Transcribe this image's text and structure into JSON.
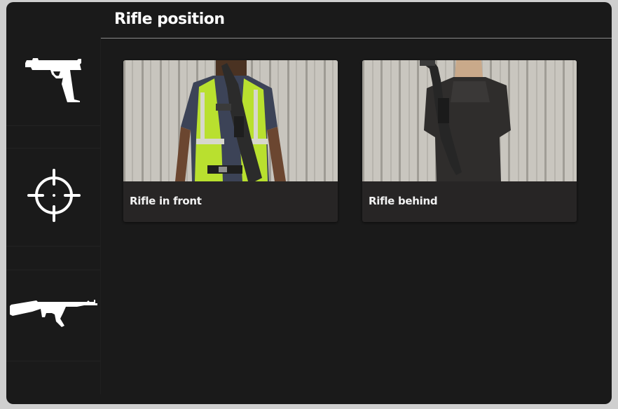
{
  "header": {
    "title": "Rifle position"
  },
  "sidebar": {
    "items": [
      {
        "icon": "pistol-icon",
        "label": ""
      },
      {
        "icon": "crosshair-icon",
        "label": ""
      },
      {
        "icon": "assault-rifle-icon",
        "label": ""
      }
    ]
  },
  "options": [
    {
      "label": "Rifle in front",
      "image": "character-rifle-front"
    },
    {
      "label": "Rifle behind",
      "image": "character-rifle-back"
    }
  ],
  "colors": {
    "background": "#1a1a1a",
    "card": "#272525",
    "text": "#ffffff",
    "vest": "#b9e02f"
  }
}
